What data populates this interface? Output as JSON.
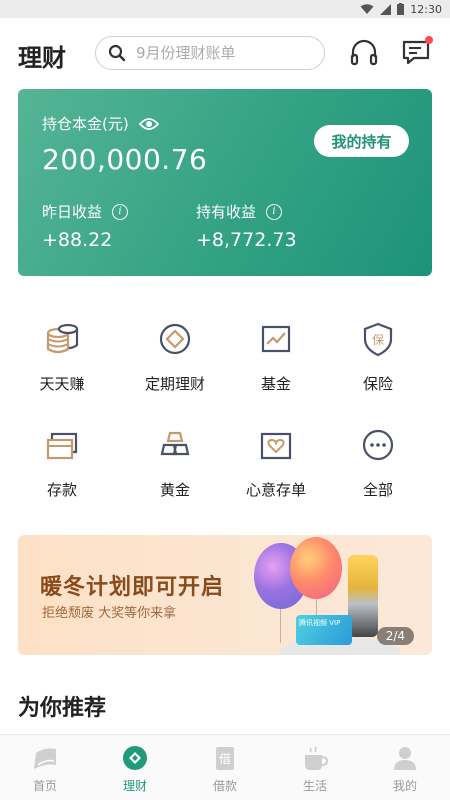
{
  "status_bar": {
    "time": "12:30"
  },
  "header": {
    "title": "理财",
    "search_placeholder": "9月份理财账单",
    "has_unread_message": true
  },
  "asset_card": {
    "principal_label": "持仓本金(元)",
    "principal_value": "200,000.76",
    "my_holdings_button": "我的持有",
    "yesterday_label": "昨日收益",
    "yesterday_value": "+88.22",
    "holding_label": "持有收益",
    "holding_value": "+8,772.73"
  },
  "categories": [
    {
      "label": "天天赚",
      "icon": "coins-icon"
    },
    {
      "label": "定期理财",
      "icon": "fixed-term-icon"
    },
    {
      "label": "基金",
      "icon": "fund-chart-icon"
    },
    {
      "label": "保险",
      "icon": "insurance-shield-icon"
    },
    {
      "label": "存款",
      "icon": "deposit-card-icon"
    },
    {
      "label": "黄金",
      "icon": "gold-bars-icon"
    },
    {
      "label": "心意存单",
      "icon": "heart-certificate-icon"
    },
    {
      "label": "全部",
      "icon": "more-dots-icon"
    }
  ],
  "banner": {
    "title": "暖冬计划即可开启",
    "subtitle": "拒绝颓废  大奖等你来拿",
    "page_indicator": "2/4",
    "card_text": "腾讯视频 VIP"
  },
  "recommend": {
    "title": "为你推荐"
  },
  "tab_bar": {
    "items": [
      {
        "label": "首页",
        "icon": "home-icon",
        "active": false
      },
      {
        "label": "理财",
        "icon": "wealth-icon",
        "active": true
      },
      {
        "label": "借款",
        "icon": "loan-icon",
        "active": false
      },
      {
        "label": "生活",
        "icon": "life-cup-icon",
        "active": false
      },
      {
        "label": "我的",
        "icon": "profile-icon",
        "active": false
      }
    ]
  },
  "colors": {
    "accent": "#1f9a7b",
    "card_gradient_start": "#55b595",
    "card_gradient_end": "#1c937a",
    "icon_gold": "#c49a6c",
    "icon_dark": "#4a5068"
  }
}
